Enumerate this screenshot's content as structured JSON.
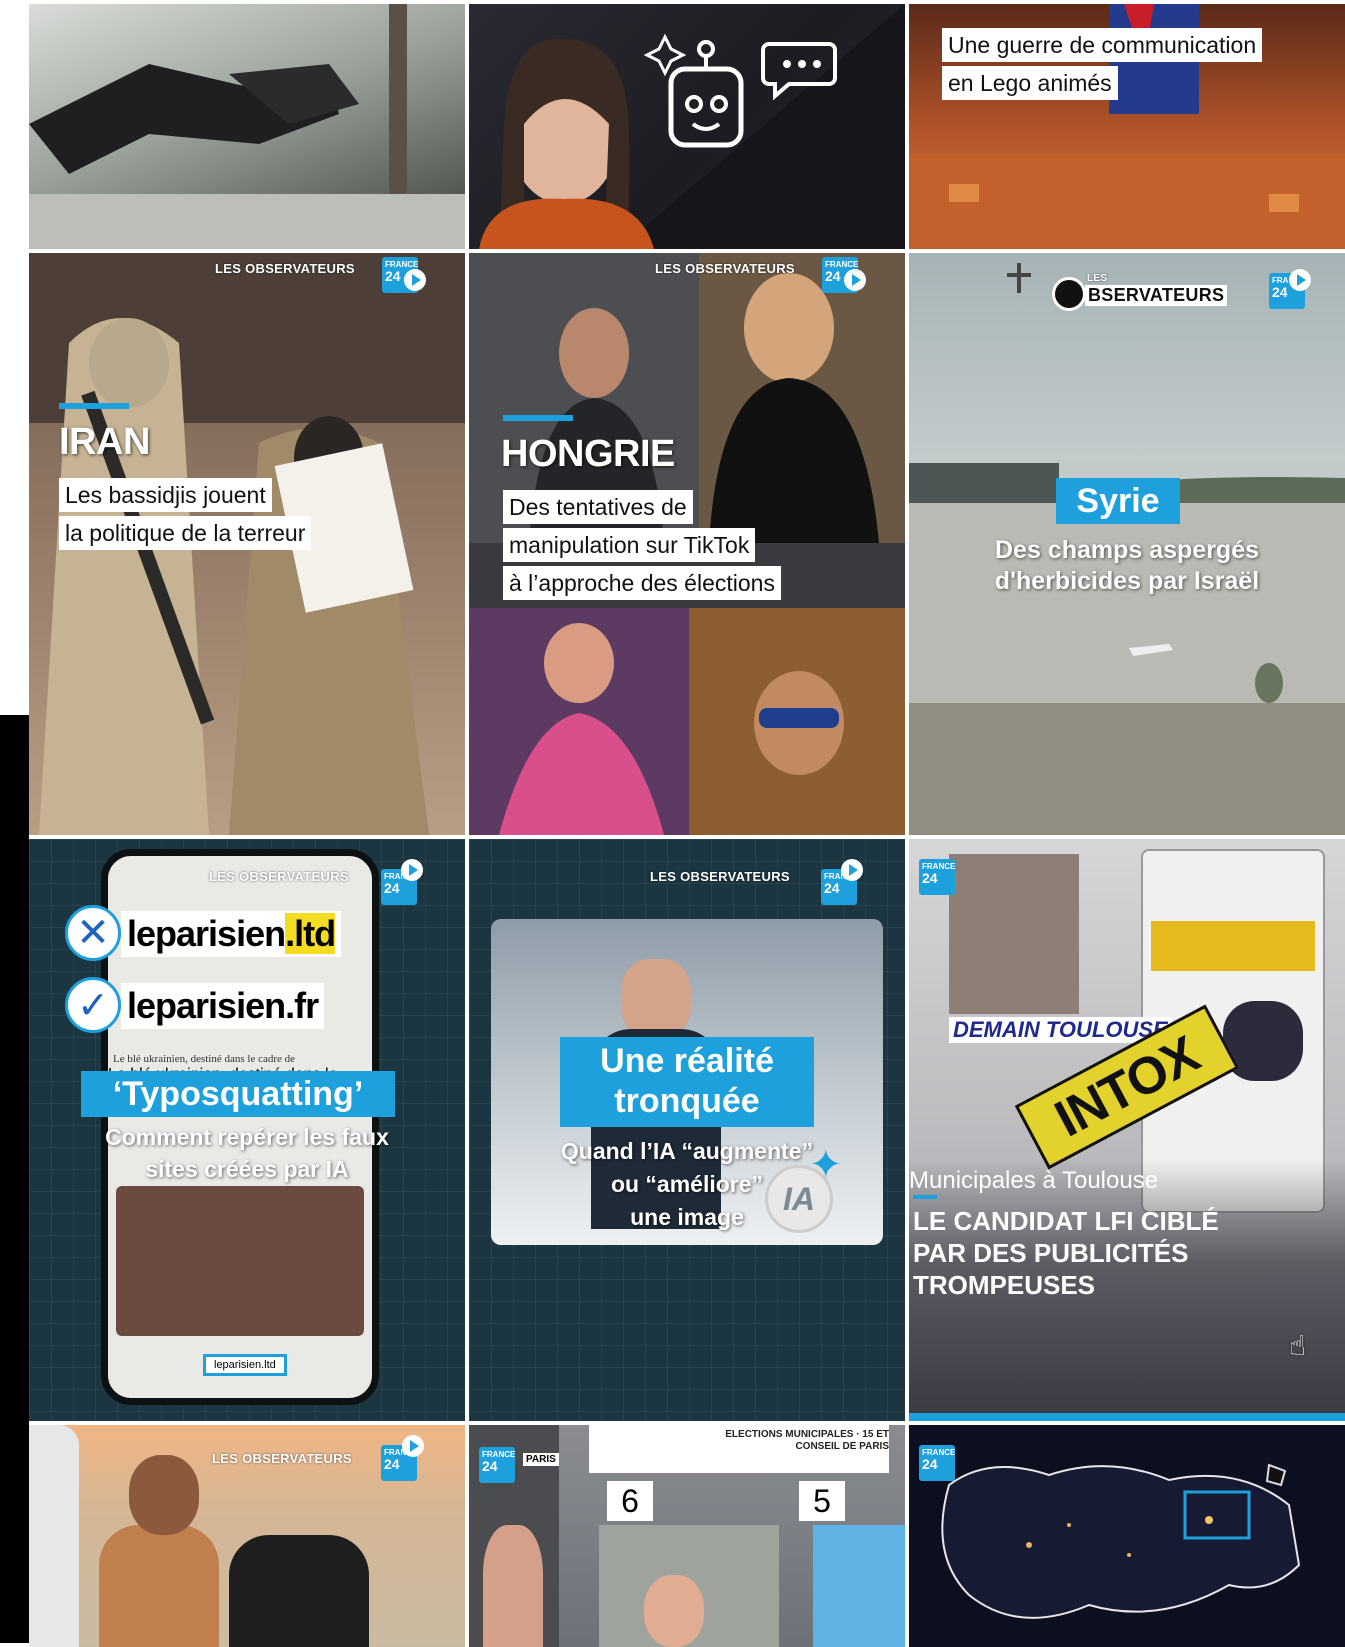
{
  "posts": [
    {
      "id": "p1"
    },
    {
      "id": "p2"
    },
    {
      "id": "p3",
      "caption_lines": [
        "Une guerre de communication",
        "en Lego animés"
      ]
    },
    {
      "id": "p4",
      "brand": "LES OBSERVATEURS",
      "title": "IRAN",
      "caption_lines": [
        "Les bassidjis jouent",
        "la politique de la terreur"
      ]
    },
    {
      "id": "p5",
      "brand": "LES OBSERVATEURS",
      "title": "HONGRIE",
      "caption_lines": [
        "Des tentatives de",
        "manipulation sur TikTok",
        "à l’approche des élections"
      ]
    },
    {
      "id": "p6",
      "brand_small": "LES",
      "brand": "BSERVATEURS",
      "title": "Syrie",
      "caption_lines": [
        "Des champs aspergés",
        "d'herbicides par Israël"
      ]
    },
    {
      "id": "p7",
      "brand": "LES OBSERVATEURS",
      "fake_domain": "leparisien.ltd",
      "fake_domain_base": "leparisien",
      "fake_domain_tld": ".ltd",
      "real_domain": "leparisien.fr",
      "paper_line": "Le blé ukrainien, destiné dans le cadre de",
      "title": "‘Typosquatting’",
      "caption_lines": [
        "Comment repérer les faux",
        "sites créées par IA"
      ],
      "url_bar": "leparisien.ltd"
    },
    {
      "id": "p8",
      "brand": "LES OBSERVATEURS",
      "title_lines": [
        "Une réalité",
        "tronquée"
      ],
      "caption_lines": [
        "Quand l’IA “augmente”",
        "ou “améliore”",
        "une image"
      ],
      "badge": "IA"
    },
    {
      "id": "p9",
      "sticker": "INTOX",
      "poster_text": "DEMAIN TOULOUSE",
      "kicker": "Municipales à Toulouse",
      "title_lines": [
        "LE CANDIDAT LFI CIBLÉ",
        "PAR DES PUBLICITÉS",
        "TROMPEUSES"
      ]
    },
    {
      "id": "p10",
      "brand": "LES OBSERVATEURS"
    },
    {
      "id": "p11",
      "header_lines": [
        "ELECTIONS MUNICIPALES · 15 ET",
        "CONSEIL DE PARIS"
      ],
      "panel_numbers": [
        "6",
        "5"
      ],
      "city": "PARIS"
    },
    {
      "id": "p12"
    }
  ],
  "france24": {
    "line1": "FRANCE",
    "line2": "24"
  },
  "colors": {
    "accent": "#1ea0dc",
    "dark_teal": "#1b3640",
    "sticker_yellow": "#e2d22b"
  }
}
